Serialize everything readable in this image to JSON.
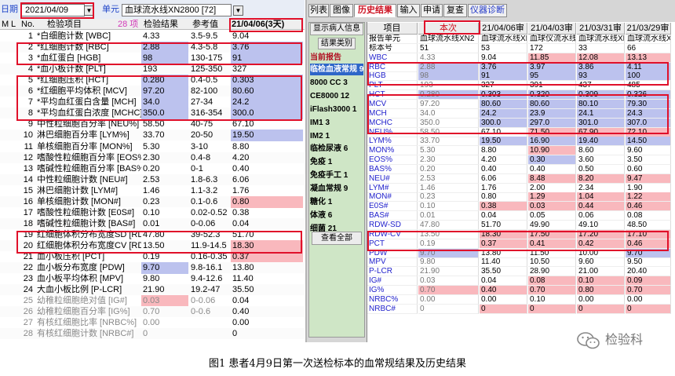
{
  "header": {
    "date_label": "日期",
    "date_value": "2021/04/09",
    "unit_label": "单元",
    "unit_value": "血球流水线XN2800 [72]"
  },
  "left": {
    "col_heads": [
      "M",
      "L",
      "No.",
      "检验项目",
      "28 项",
      "检验结果",
      "参考值",
      "21/04/06(3天)"
    ],
    "rows": [
      [
        "1",
        "*白细胞计数 [WBC]",
        "4.33",
        "3.5-9.5",
        "9.04"
      ],
      [
        "2",
        "*红细胞计数 [RBC]",
        "2.88",
        "4.3-5.8",
        "3.76"
      ],
      [
        "3",
        "*血红蛋白 [HGB]",
        "98",
        "130-175",
        "91"
      ],
      [
        "4",
        "*血小板计数 [PLT]",
        "193",
        "125-350",
        "327"
      ],
      [
        "5",
        "*红细胞压积 [HCT]",
        "0.280",
        "0.4-0.5",
        "0.303"
      ],
      [
        "6",
        "*红细胞平均体积 [MCV]",
        "97.20",
        "82-100",
        "80.60"
      ],
      [
        "7",
        "*平均血红蛋白含量 [MCH]",
        "34.0",
        "27-34",
        "24.2"
      ],
      [
        "8",
        "*平均血红蛋白浓度 [MCHC]",
        "350.0",
        "316-354",
        "300.0"
      ],
      [
        "9",
        "中性粒细胞百分率 [NEU%]",
        "58.50",
        "40-75",
        "67.10"
      ],
      [
        "10",
        "淋巴细胞百分率 [LYM%]",
        "33.70",
        "20-50",
        "19.50"
      ],
      [
        "11",
        "单核细胞百分率 [MON%]",
        "5.30",
        "3-10",
        "8.80"
      ],
      [
        "12",
        "嗜酸性粒细胞百分率 [EOS%]",
        "2.30",
        "0.4-8",
        "4.20"
      ],
      [
        "13",
        "嗜碱性粒细胞百分率 [BAS%]",
        "0.20",
        "0-1",
        "0.40"
      ],
      [
        "14",
        "中性粒细胞计数 [NEU#]",
        "2.53",
        "1.8-6.3",
        "6.06"
      ],
      [
        "15",
        "淋巴细胞计数 [LYM#]",
        "1.46",
        "1.1-3.2",
        "1.76"
      ],
      [
        "16",
        "单核细胞计数 [MON#]",
        "0.23",
        "0.1-0.6",
        "0.80"
      ],
      [
        "17",
        "嗜酸性粒细胞计数 [E0S#]",
        "0.10",
        "0.02-0.52",
        "0.38"
      ],
      [
        "18",
        "嗜碱性粒细胞计数 [BAS#]",
        "0.01",
        "0-0.06",
        "0.04"
      ],
      [
        "19",
        "红细胞体积分布宽度SD [RD",
        "47.80",
        "39-52.3",
        "51.70"
      ],
      [
        "20",
        "红细胞体积分布宽度CV [RD",
        "13.50",
        "11.9-14.5",
        "18.30"
      ],
      [
        "21",
        "血小板压积 [PCT]",
        "0.19",
        "0.16-0.35",
        "0.37"
      ],
      [
        "22",
        "血小板分布宽度 [PDW]",
        "9.70",
        "9.8-16.1",
        "13.80"
      ],
      [
        "23",
        "血小板平均体积 [MPV]",
        "9.80",
        "9.4-12.6",
        "11.40"
      ],
      [
        "24",
        "大血小板比例 [P-LCR]",
        "21.90",
        "19.2-47",
        "35.50"
      ],
      [
        "25",
        "幼稚粒细胞绝对值 [IG#]",
        "0.03",
        "0-0.06",
        "0.04"
      ],
      [
        "26",
        "幼稚粒细胞百分率 [IG%]",
        "0.70",
        "0-0.6",
        "0.40"
      ],
      [
        "27",
        "有核红细胞比率 [NRBC%]",
        "0.00",
        "",
        "0.00"
      ],
      [
        "28",
        "有核红细胞计数 [NRBC#]",
        "0",
        "",
        "0"
      ]
    ]
  },
  "right": {
    "top_tabs": [
      "列表",
      "图像",
      "历史结果",
      "输入",
      "申请",
      "复查",
      "仪器诊断"
    ],
    "side_buttons": [
      "显示病人信息",
      "结果类别",
      "查看全部"
    ],
    "current_report": "当前报告",
    "categories": [
      "临检血液常规 9",
      "8000 CC 3",
      "CE8000 12",
      "iFlash3000 1",
      "IM1 3",
      "IM2 1",
      "临检尿液 6",
      "免疫 1",
      "免疫手工 1",
      "凝血常规 9",
      "糖化 1",
      "体液 6",
      "细菌 21"
    ],
    "table_head": [
      "项目",
      "本次",
      "21/04/06审",
      "21/04/03审",
      "21/03/31审",
      "21/03/29审"
    ],
    "meta_rows": [
      [
        "报告单元",
        "血球流水线XN2",
        "血球流水线XN2",
        "血球仪流水线",
        "血球流水线XN",
        "血球流水线XN"
      ],
      [
        "标本号",
        "51",
        "53",
        "172",
        "33",
        "66"
      ]
    ],
    "rows": [
      [
        "WBC",
        "4.33",
        "9.04",
        "11.85",
        "12.08",
        "13.13"
      ],
      [
        "RBC",
        "2.88",
        "3.76",
        "3.97",
        "3.86",
        "4.11"
      ],
      [
        "HGB",
        "98",
        "91",
        "95",
        "93",
        "100"
      ],
      [
        "PLT",
        "193",
        "327",
        "391",
        "437",
        "485"
      ],
      [
        "HCT",
        "0.280",
        "0.303",
        "0.320",
        "0.309",
        "0.326"
      ],
      [
        "MCV",
        "97.20",
        "80.60",
        "80.60",
        "80.10",
        "79.30"
      ],
      [
        "MCH",
        "34.0",
        "24.2",
        "23.9",
        "24.1",
        "24.3"
      ],
      [
        "MCHC",
        "350.0",
        "300.0",
        "297.0",
        "301.0",
        "307.0"
      ],
      [
        "NEU%",
        "58.50",
        "67.10",
        "71.50",
        "67.90",
        "72.10"
      ],
      [
        "LYM%",
        "33.70",
        "19.50",
        "16.90",
        "19.40",
        "14.50"
      ],
      [
        "MON%",
        "5.30",
        "8.80",
        "10.90",
        "8.60",
        "9.60"
      ],
      [
        "EOS%",
        "2.30",
        "4.20",
        "0.30",
        "3.60",
        "3.50"
      ],
      [
        "BAS%",
        "0.20",
        "0.40",
        "0.40",
        "0.50",
        "0.60"
      ],
      [
        "NEU#",
        "2.53",
        "6.06",
        "8.48",
        "8.20",
        "9.47"
      ],
      [
        "LYM#",
        "1.46",
        "1.76",
        "2.00",
        "2.34",
        "1.90"
      ],
      [
        "MON#",
        "0.23",
        "0.80",
        "1.29",
        "1.04",
        "1.22"
      ],
      [
        "E0S#",
        "0.10",
        "0.38",
        "0.03",
        "0.44",
        "0.46"
      ],
      [
        "BAS#",
        "0.01",
        "0.04",
        "0.05",
        "0.06",
        "0.08"
      ],
      [
        "RDW-SD",
        "47.80",
        "51.70",
        "49.90",
        "49.10",
        "48.50"
      ],
      [
        "RDW-CV",
        "13.50",
        "18.30",
        "17.50",
        "17.20",
        "17.10"
      ],
      [
        "PCT",
        "0.19",
        "0.37",
        "0.41",
        "0.42",
        "0.46"
      ],
      [
        "PDW",
        "9.70",
        "13.80",
        "11.50",
        "10.00",
        "9.70"
      ],
      [
        "MPV",
        "9.80",
        "11.40",
        "10.50",
        "9.60",
        "9.50"
      ],
      [
        "P-LCR",
        "21.90",
        "35.50",
        "28.90",
        "21.00",
        "20.40"
      ],
      [
        "IG#",
        "0.03",
        "0.04",
        "0.08",
        "0.10",
        "0.09"
      ],
      [
        "IG%",
        "0.70",
        "0.40",
        "0.70",
        "0.80",
        "0.70"
      ],
      [
        "NRBC%",
        "0.00",
        "0.00",
        "0.10",
        "0.00",
        "0.00"
      ],
      [
        "NRBC#",
        "0",
        "0",
        "0",
        "0",
        "0"
      ]
    ]
  },
  "caption": "图1  患者4月9日第一次送检标本的血常规结果及历史结果",
  "watermark": "检验科",
  "colors": {
    "high": "#f9b8bd",
    "low": "#bcc2ee",
    "blue_text": "#2222cc",
    "red_box": "#e0102a",
    "sidebar_green": "#cfe6c6"
  }
}
